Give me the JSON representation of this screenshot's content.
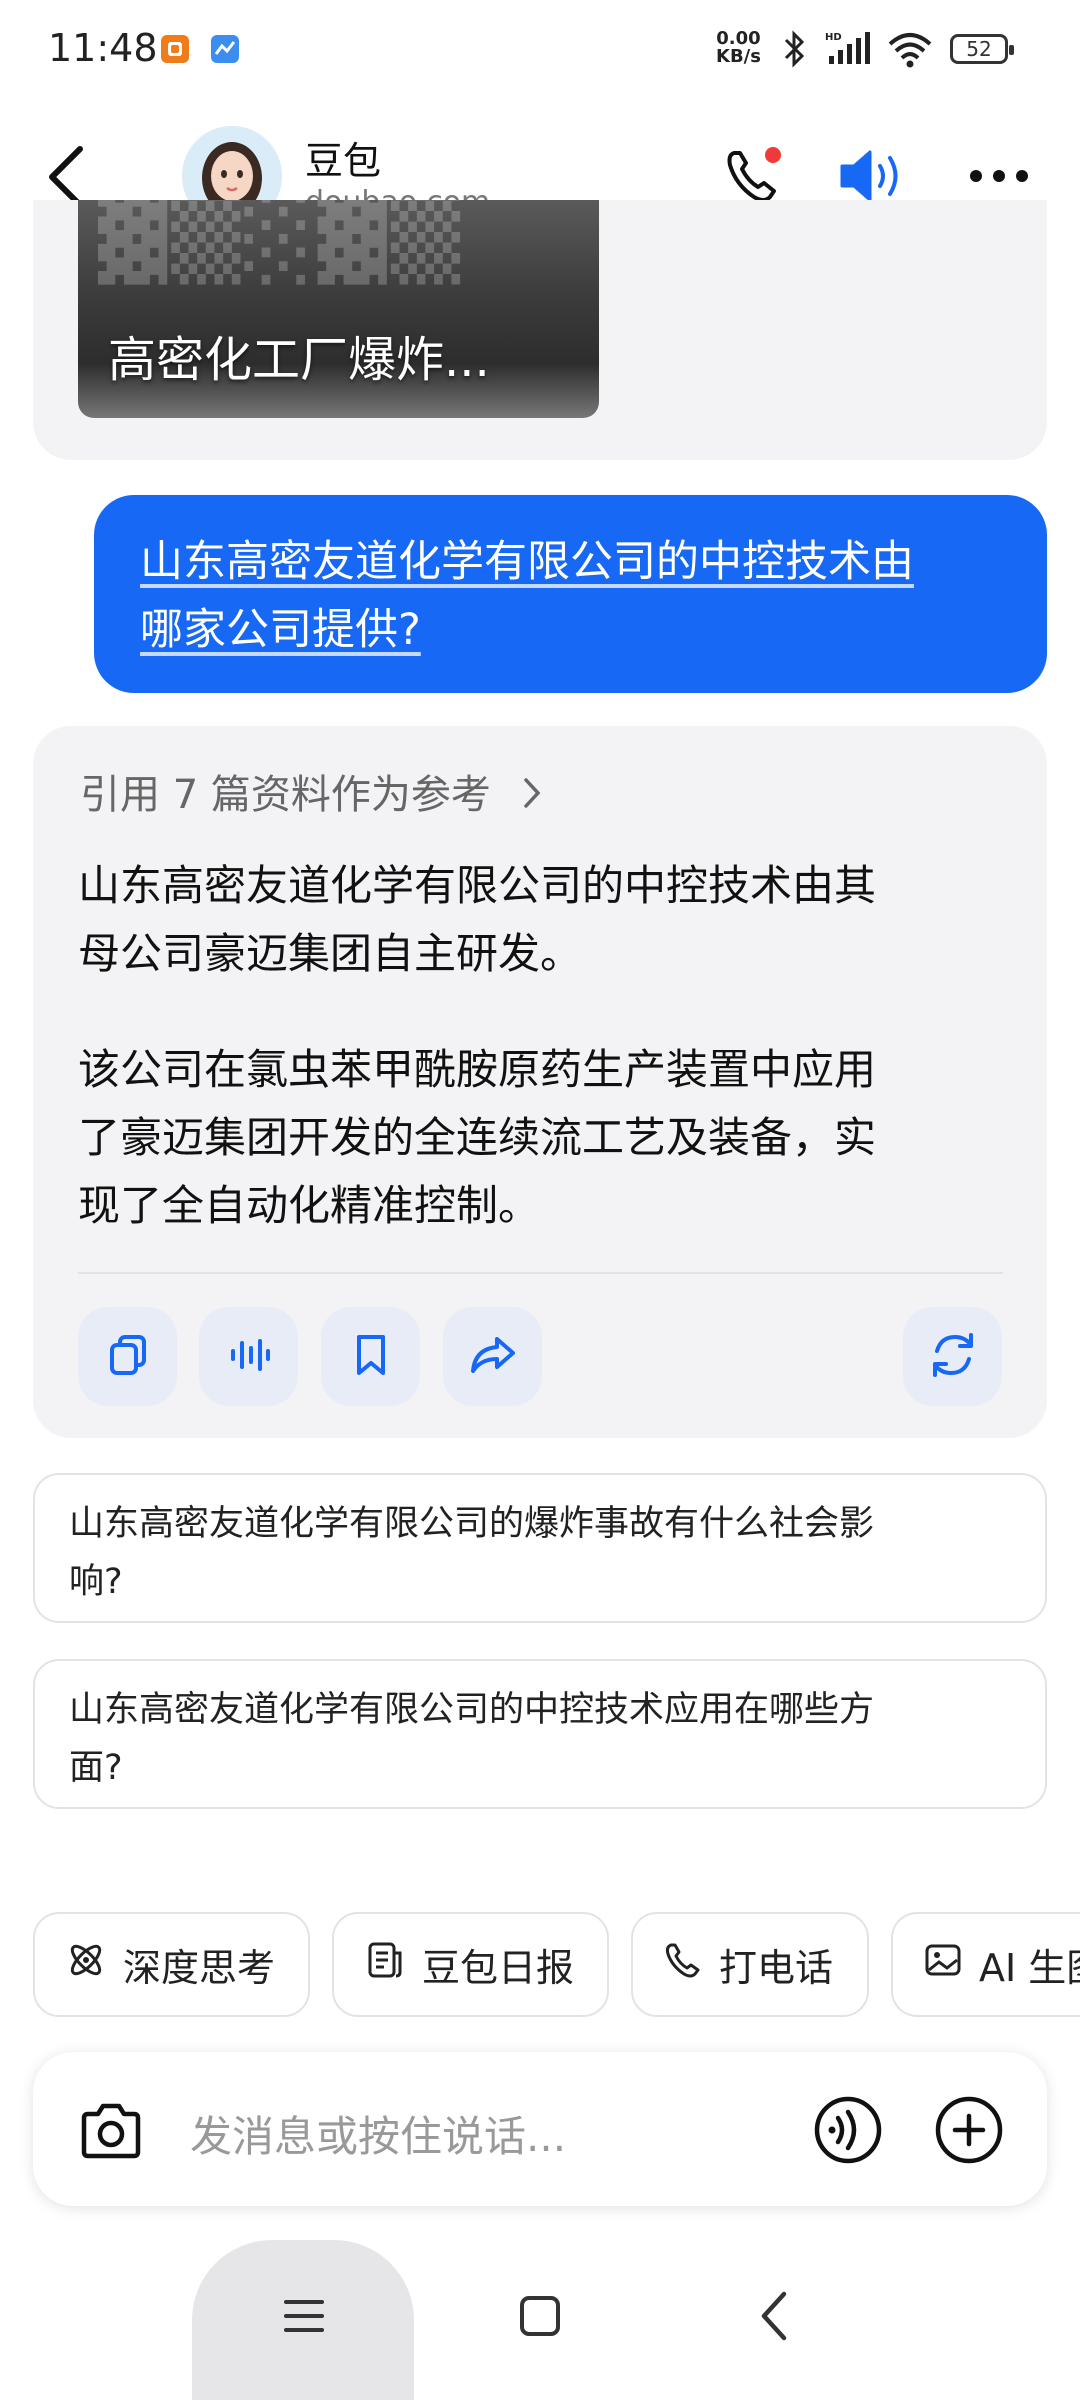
{
  "status_bar": {
    "time": "11:48",
    "net_speed_value": "0.00",
    "net_speed_unit": "KB/s",
    "battery": "52"
  },
  "header": {
    "name": "豆包",
    "domain": "doubao.com",
    "icons": [
      "back-arrow-icon",
      "phone-call-icon",
      "speaker-icon",
      "more-icon"
    ]
  },
  "previous_message": {
    "video_title": "高密化工厂爆炸..."
  },
  "user_message": {
    "line1": "山东高密友道化学有限公司的中控技术由",
    "line2": "哪家公司提供?"
  },
  "answer": {
    "reference_text": "引用 7 篇资料作为参考",
    "p1_line1": "山东高密友道化学有限公司的中控技术由其",
    "p1_line2": "母公司豪迈集团自主研发。",
    "p2_line1": "该公司在氯虫苯甲酰胺原药生产装置中应用",
    "p2_line2": "了豪迈集团开发的全连续流工艺及装备，实",
    "p2_line3": "现了全自动化精准控制。",
    "actions": [
      "copy-icon",
      "voice-play-icon",
      "bookmark-icon",
      "share-icon",
      "regenerate-icon"
    ]
  },
  "suggestions": [
    {
      "line1": "山东高密友道化学有限公司的爆炸事故有什么社会影",
      "line2": "响?"
    },
    {
      "line1": "山东高密友道化学有限公司的中控技术应用在哪些方",
      "line2": "面?"
    }
  ],
  "chips": [
    {
      "label": "深度思考",
      "icon": "atom-icon"
    },
    {
      "label": "豆包日报",
      "icon": "newspaper-icon"
    },
    {
      "label": "打电话",
      "icon": "phone-icon"
    },
    {
      "label": "AI 生图",
      "icon": "image-icon"
    }
  ],
  "input": {
    "placeholder": "发消息或按住说话..."
  },
  "colors": {
    "accent": "#1668f5",
    "card_bg": "#f3f3f5",
    "notification_dot": "#f03a3a"
  }
}
